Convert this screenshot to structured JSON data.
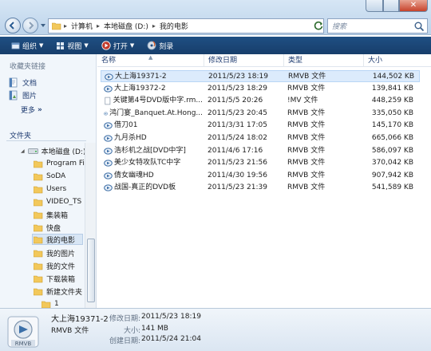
{
  "window": {
    "close_glyph": "✕"
  },
  "address": {
    "crumbs": [
      "计算机",
      "本地磁盘 (D:)",
      "我的电影"
    ],
    "separator": "▸"
  },
  "search": {
    "placeholder": "搜索"
  },
  "toolbar": {
    "organize": "组织",
    "views": "视图",
    "open": "打开",
    "burn": "刻录",
    "dropdown_arrow": "▼"
  },
  "sidebar": {
    "favorites_title": "收藏夹链接",
    "favorites": [
      "文档",
      "图片"
    ],
    "more": "更多",
    "more_glyph": "»",
    "folders_title": "文件夹",
    "tree": [
      {
        "label": "本地磁盘 (D:)",
        "kind": "drive",
        "expanded": true
      },
      {
        "label": "Program Fil",
        "kind": "folder"
      },
      {
        "label": "SoDA",
        "kind": "folder"
      },
      {
        "label": "Users",
        "kind": "folder"
      },
      {
        "label": "VIDEO_TS",
        "kind": "folder"
      },
      {
        "label": "集装箱",
        "kind": "folder"
      },
      {
        "label": "快盘",
        "kind": "folder"
      },
      {
        "label": "我的电影",
        "kind": "folder",
        "selected": true
      },
      {
        "label": "我的图片",
        "kind": "folder"
      },
      {
        "label": "我的文件",
        "kind": "folder"
      },
      {
        "label": "下载装箱",
        "kind": "folder"
      },
      {
        "label": "新建文件夹",
        "kind": "folder"
      },
      {
        "label": "1",
        "kind": "folder"
      }
    ]
  },
  "columns": {
    "name": "名称",
    "date": "修改日期",
    "type": "类型",
    "size": "大小"
  },
  "files": [
    {
      "name": "大上海19371-2",
      "date": "2011/5/23 18:19",
      "type": "RMVB 文件",
      "size": "144,502 KB",
      "icon": "rmvb-icon",
      "selected": true
    },
    {
      "name": "大上海19372-2",
      "date": "2011/5/23 18:29",
      "type": "RMVB 文件",
      "size": "139,841 KB",
      "icon": "rmvb-icon"
    },
    {
      "name": "关键第4号DVD版中字.rm...",
      "date": "2011/5/5 20:26",
      "type": "!MV 文件",
      "size": "448,259 KB",
      "icon": "document-icon"
    },
    {
      "name": "鸿门宴_Banquet.At.Hong...",
      "date": "2011/5/23 20:45",
      "type": "RMVB 文件",
      "size": "335,050 KB",
      "icon": "rmvb-icon"
    },
    {
      "name": "借刀01",
      "date": "2011/3/31 17:05",
      "type": "RMVB 文件",
      "size": "145,170 KB",
      "icon": "rmvb-icon"
    },
    {
      "name": "九月杀HD",
      "date": "2011/5/24 18:02",
      "type": "RMVB 文件",
      "size": "665,066 KB",
      "icon": "rmvb-icon"
    },
    {
      "name": "浩杉机之战[DVD中字]",
      "date": "2011/4/6 17:16",
      "type": "RMVB 文件",
      "size": "586,097 KB",
      "icon": "rmvb-icon"
    },
    {
      "name": "美少女特攻队TC中字",
      "date": "2011/5/23 21:56",
      "type": "RMVB 文件",
      "size": "370,042 KB",
      "icon": "rmvb-icon"
    },
    {
      "name": "倩女幽魂HD",
      "date": "2011/4/30 19:56",
      "type": "RMVB 文件",
      "size": "907,942 KB",
      "icon": "rmvb-icon"
    },
    {
      "name": "战国-真正的DVD板",
      "date": "2011/5/23 21:39",
      "type": "RMVB 文件",
      "size": "541,589 KB",
      "icon": "rmvb-icon"
    }
  ],
  "details": {
    "thumb_label": "RMVB",
    "file_name": "大上海19371-2",
    "file_type": "RMVB 文件",
    "modified_label": "修改日期:",
    "modified_value": "2011/5/23 18:19",
    "size_label": "大小:",
    "size_value": "141 MB",
    "created_label": "创建日期:",
    "created_value": "2011/5/24 21:04"
  },
  "colors": {
    "toolbar": "#1f4f83",
    "selection": "#dcebfc",
    "link": "#1e3b70"
  }
}
